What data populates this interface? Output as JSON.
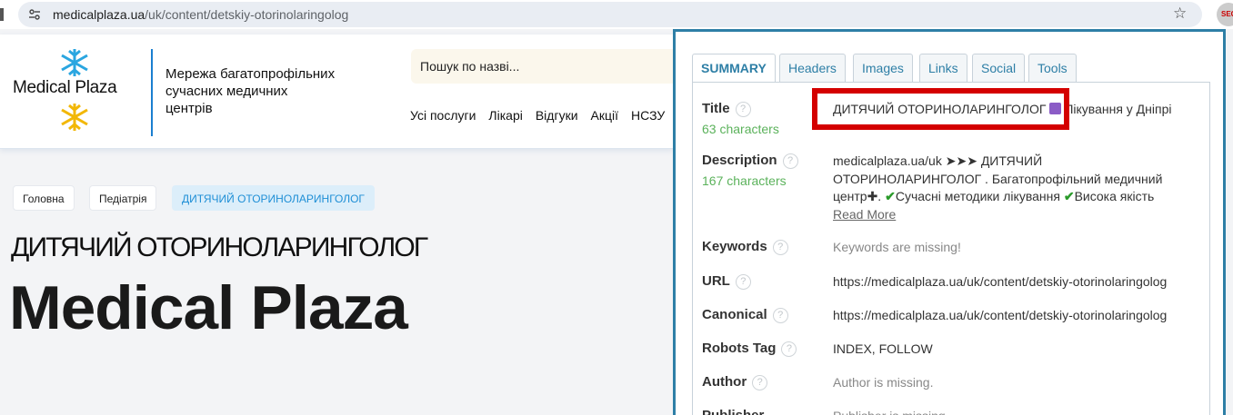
{
  "browser": {
    "url_host": "medicalplaza.ua",
    "url_path": "/uk/content/detskiy-otorinolaringolog",
    "ext_label": "SEO"
  },
  "site": {
    "logo_text": "Medical Plaza",
    "tagline_1": "Мережа багатопрофільних",
    "tagline_2": "сучасних медичних",
    "tagline_3": "центрів",
    "search_placeholder": "Пошук по назві...",
    "menu": [
      "Усі послуги",
      "Лікарі",
      "Відгуки",
      "Акції",
      "НСЗУ"
    ],
    "breadcrumbs": [
      "Головна",
      "Педіатрія",
      "ДИТЯЧИЙ ОТОРИНОЛАРИНГОЛОГ"
    ],
    "page_title": "ДИТЯЧИЙ ОТОРИНОЛАРИНГОЛОГ",
    "brand_heading": "Medical Plaza"
  },
  "seo": {
    "tabs": [
      "SUMMARY",
      "Headers",
      "Images",
      "Links",
      "Social",
      "Tools"
    ],
    "title_label": "Title",
    "title_count": "63 characters",
    "title_value_1": "ДИТЯЧИЙ ОТОРИНОЛАРИНГОЛОГ",
    "title_value_2": "Лікування у Дніпрі",
    "description_label": "Description",
    "description_count": "167 characters",
    "description_line_1": "medicalplaza.ua/uk ➤➤➤ ДИТЯЧИЙ",
    "description_line_2": "ОТОРИНОЛАРИНГОЛОГ . Багатопрофільний медичний",
    "description_line_3a": "центр✚.",
    "description_line_3b": "Сучасні методики лікування",
    "description_line_3c": "Висока якість",
    "read_more": "Read More",
    "keywords_label": "Keywords",
    "keywords_value": "Keywords are missing!",
    "url_label": "URL",
    "url_value": "https://medicalplaza.ua/uk/content/detskiy-otorinolaringolog",
    "canonical_label": "Canonical",
    "canonical_value": "https://medicalplaza.ua/uk/content/detskiy-otorinolaringolog",
    "robots_label": "Robots Tag",
    "robots_value": "INDEX, FOLLOW",
    "author_label": "Author",
    "author_value": "Author is missing.",
    "publisher_label": "Publisher",
    "publisher_value": "Publisher is missing."
  },
  "colors": {
    "accent": "#2e7fa6",
    "highlight": "#d40000",
    "brand_blue": "#1b7fd0"
  }
}
